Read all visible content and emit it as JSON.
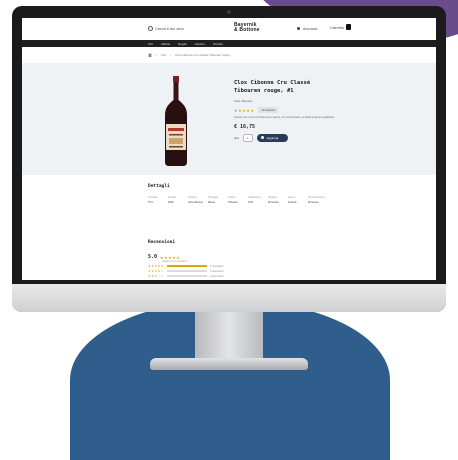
{
  "header": {
    "search_placeholder": "Cerca il tuo vino",
    "logo_line1": "Bayernik",
    "logo_line2": "& Bottone",
    "account_label": "Account",
    "cart_label": "Carrello"
  },
  "nav": {
    "items": [
      "Vini",
      "Offerte",
      "Regali",
      "Cantine",
      "Territori"
    ]
  },
  "breadcrumb": {
    "items": [
      "Vini",
      "Cios Cibonne Cru Classé Tibouren rouge"
    ]
  },
  "product": {
    "title_line1": "Clos Cibonne Cru Classé",
    "title_line2": "Tibouren rouge, #1",
    "producer": "Clos Cibonne",
    "rating_stars": "★★★★★",
    "badge": "Vini Rossi",
    "description": "Questo vino è ricco di frutta nera e spezie, con note floreali e un finale lungo ed equilibrato.",
    "price": "€ 16,75",
    "qty_label": "Qtà",
    "qty_value": "1",
    "add_to_cart": "Aggiungi"
  },
  "details": {
    "title": "Dettagli",
    "items": [
      {
        "label": "Formato",
        "value": "75 cl"
      },
      {
        "label": "Annata",
        "value": "2018"
      },
      {
        "label": "Cantina",
        "value": "Clos Cibonne"
      },
      {
        "label": "Tipologia",
        "value": "Rosso"
      },
      {
        "label": "Vitigno",
        "value": "Tibouren"
      },
      {
        "label": "Gradazione",
        "value": "14%"
      },
      {
        "label": "Regione",
        "value": "Provenza"
      },
      {
        "label": "Paese",
        "value": "Francia"
      },
      {
        "label": "Denominazione",
        "value": "Provence"
      }
    ]
  },
  "reviews": {
    "title": "Recensioni",
    "score": "5.0",
    "stars": "★★★★★",
    "count_label": "basato su 3 recensioni",
    "rows": [
      {
        "stars": "★★★★★",
        "fraction": 1.0,
        "label": "3 recensioni"
      },
      {
        "stars": "★★★★☆",
        "fraction": 0.0,
        "label": "0 recensioni"
      },
      {
        "stars": "★★★☆☆",
        "fraction": 0.0,
        "label": "0 recensioni"
      }
    ]
  },
  "colors": {
    "accent": "#2b3a55",
    "star": "#e0a800",
    "band": "#eef2f5"
  }
}
